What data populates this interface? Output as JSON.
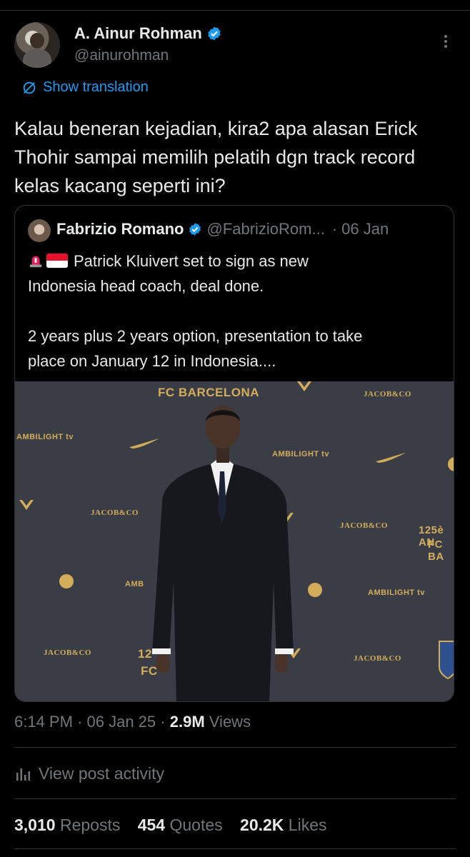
{
  "tweet": {
    "display_name": "A. Ainur Rohman",
    "handle": "@ainurohman",
    "show_translation": "Show translation",
    "text": "Kalau beneran kejadian, kira2 apa alasan Erick Thohir sampai memilih pelatih dgn track record kelas kacang seperti ini?",
    "time": "6:14 PM",
    "date": "06 Jan 25",
    "views_count": "2.9M",
    "views_label": "Views",
    "activity_label": "View post activity"
  },
  "quote": {
    "display_name": "Fabrizio Romano",
    "handle": "@FabrizioRom...",
    "date": "06 Jan",
    "line1": "Patrick Kluivert set to sign as new",
    "line2": "Indonesia head coach, deal done.",
    "line3": "2 years plus 2 years option, presentation to take",
    "line4": "place on January 12 in Indonesia....",
    "image_wall_text": {
      "fcb": "FC BARCELONA",
      "ambilight": "AMBILIGHT tv",
      "jacob": "JACOB&CO",
      "anniv": "125è AN",
      "fcb_short": "FC BA",
      "amb_short": "AMB",
      "num_short": "12",
      "fc_short": "FC"
    }
  },
  "stats": {
    "reposts_count": "3,010",
    "reposts_label": "Reposts",
    "quotes_count": "454",
    "quotes_label": "Quotes",
    "likes_count": "20.2K",
    "likes_label": "Likes"
  },
  "colors": {
    "background": "#000000",
    "primary_text": "#e7e9ea",
    "secondary_text": "#71767b",
    "accent": "#1d9bf0",
    "divider": "#2f3336"
  },
  "icons": [
    "verified-badge-icon",
    "more-options-icon",
    "translate-icon",
    "siren-emoji",
    "indonesia-flag-emoji",
    "analytics-icon"
  ]
}
